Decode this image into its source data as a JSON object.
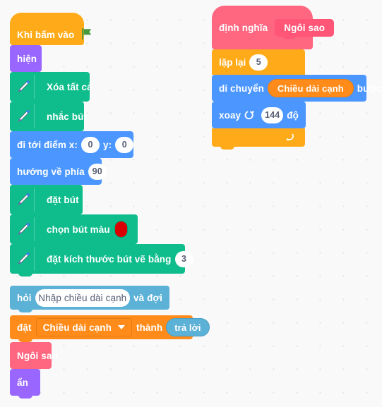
{
  "app": {
    "canvas_label": "scratch-blocks-workspace",
    "background_color": "#f9f9f9"
  },
  "palette_colors": {
    "events": "#ffab19",
    "looks": "#9966ff",
    "pen": "#0fbd8c",
    "motion": "#4c97ff",
    "sensing": "#5cb1d6",
    "variables": "#ff8c1a",
    "my_blocks": "#ff6680",
    "control": "#ffab19",
    "pen_color_swatch": "#d90000",
    "green_flag": "#45993d"
  },
  "scripts": {
    "main_script": {
      "hat": {
        "label": "Khi bấm vào",
        "icon": "green-flag-icon"
      },
      "blocks": [
        {
          "id": "show",
          "label": "hiện",
          "category": "looks"
        },
        {
          "id": "erase-all",
          "label": "Xóa tất cả",
          "category": "pen",
          "icon": "pen-icon"
        },
        {
          "id": "pen-up",
          "label": "nhắc bút",
          "category": "pen",
          "icon": "pen-icon"
        },
        {
          "id": "goto-xy",
          "label_x": "đi tới điểm x:",
          "value_x": "0",
          "label_y": "y:",
          "value_y": "0",
          "category": "motion"
        },
        {
          "id": "point-dir",
          "label": "hướng về phía",
          "value": "90",
          "category": "motion"
        },
        {
          "id": "pen-down",
          "label": "đặt bút",
          "category": "pen",
          "icon": "pen-icon"
        },
        {
          "id": "set-pen-color",
          "label": "chọn bút màu",
          "color": "#d90000",
          "category": "pen",
          "icon": "pen-icon"
        },
        {
          "id": "set-pen-size",
          "label": "đặt kích thước bút vẽ bằng",
          "value": "3",
          "category": "pen",
          "icon": "pen-icon"
        },
        {
          "id": "ask-wait",
          "label_pre": "hỏi",
          "value": "Nhập chiều dài cạnh",
          "label_post": "và đợi",
          "category": "sensing"
        },
        {
          "id": "set-var",
          "label_pre": "đặt",
          "variable": "Chiều dài cạnh",
          "label_mid": "thành",
          "reporter": "trả lời",
          "category": "variables"
        },
        {
          "id": "call-star",
          "label": "Ngôi sao",
          "category": "my_blocks"
        },
        {
          "id": "hide",
          "label": "ẩn",
          "category": "looks"
        }
      ]
    },
    "definition_script": {
      "hat": {
        "label": "định nghĩa",
        "procedure_name": "Ngôi sao"
      },
      "repeat": {
        "label": "lặp lại",
        "value": "5",
        "loop_icon": "loop-arrow-icon",
        "body": [
          {
            "id": "move",
            "label_pre": "di chuyển",
            "reporter": "Chiều dài cạnh",
            "label_post": "bước",
            "category": "motion"
          },
          {
            "id": "turn-right",
            "label_pre": "xoay",
            "icon": "turn-clockwise-icon",
            "value": "144",
            "label_post": "độ",
            "category": "motion"
          }
        ]
      }
    }
  }
}
